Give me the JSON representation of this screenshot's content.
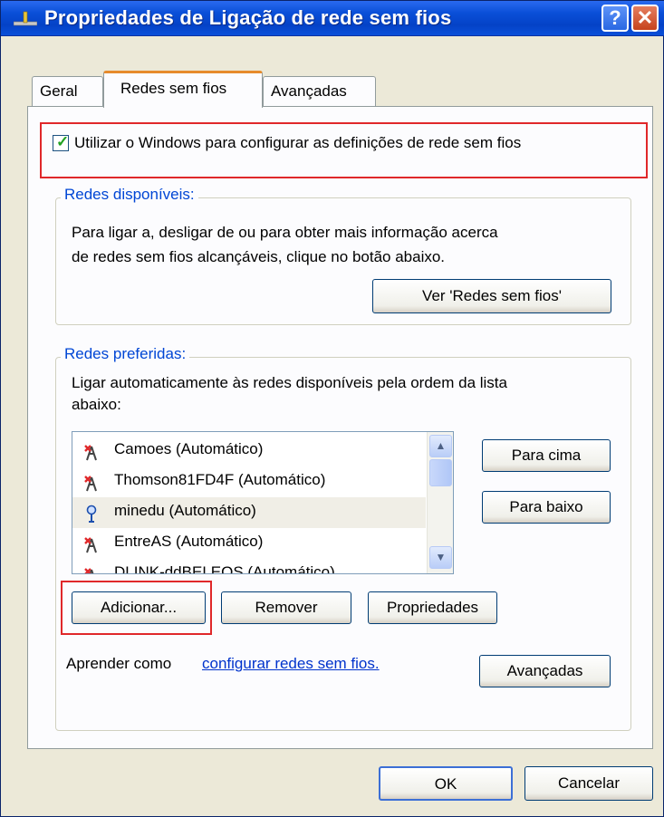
{
  "window": {
    "title": "Propriedades de Ligação de rede sem fios",
    "help_glyph": "?",
    "close_glyph": "✕"
  },
  "tabs": [
    {
      "label": "Geral",
      "active": false
    },
    {
      "label": "Redes sem fios",
      "active": true
    },
    {
      "label": "Avançadas",
      "active": false
    }
  ],
  "use_windows": {
    "checked": true,
    "label": "Utilizar o Windows para configurar as definições de rede sem fios"
  },
  "available": {
    "title": "Redes disponíveis:",
    "line1": "Para ligar a, desligar de ou para obter mais informação acerca",
    "line2": "de redes sem fios alcançáveis, clique no botão abaixo.",
    "view_button": "Ver 'Redes sem fios'"
  },
  "preferred": {
    "title": "Redes preferidas:",
    "line1": "Ligar automaticamente às redes disponíveis pela ordem da lista",
    "line2": "abaixo:",
    "networks": [
      {
        "label": "Camoes (Automático)",
        "icon": "wireless-disconnected-icon",
        "selected": false
      },
      {
        "label": "Thomson81FD4F (Automático)",
        "icon": "wireless-disconnected-icon",
        "selected": false
      },
      {
        "label": "minedu (Automático)",
        "icon": "wireless-connected-icon",
        "selected": true
      },
      {
        "label": "EntreAS (Automático)",
        "icon": "wireless-disconnected-icon",
        "selected": false
      },
      {
        "label": "DLINK-ddBELEOS (Automático)",
        "icon": "wireless-disconnected-icon",
        "selected": false
      }
    ],
    "move_up": "Para cima",
    "move_down": "Para baixo",
    "add": "Adicionar...",
    "remove": "Remover",
    "properties": "Propriedades",
    "learn_text": "Aprender como",
    "learn_link": "configurar redes sem fios.",
    "advanced": "Avançadas"
  },
  "footer": {
    "ok": "OK",
    "cancel": "Cancelar"
  },
  "colors": {
    "title_bar": "#0a4fd8",
    "group_title": "#0046d5",
    "highlight_box": "#e0282a",
    "link": "#0033cc"
  }
}
